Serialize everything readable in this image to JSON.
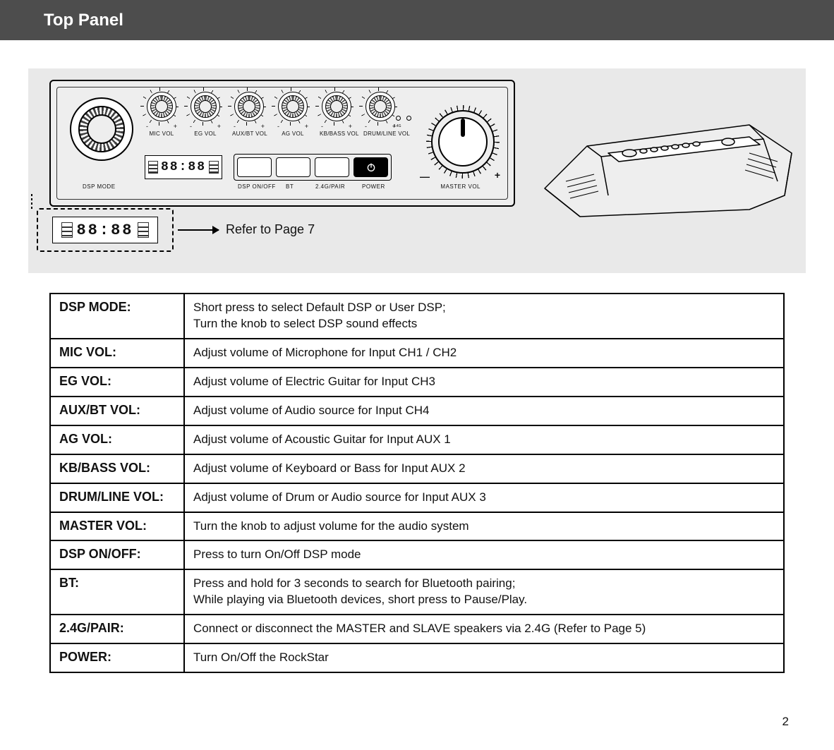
{
  "header": {
    "title": "Top Panel"
  },
  "panel": {
    "dsp_mode_label": "DSP MODE",
    "knobs": [
      {
        "label": "MIC VOL"
      },
      {
        "label": "EG VOL"
      },
      {
        "label": "AUX/BT VOL"
      },
      {
        "label": "AG VOL"
      },
      {
        "label": "KB/BASS VOL"
      },
      {
        "label": "DRUM/LINE VOL"
      }
    ],
    "knob_minus": "-",
    "knob_plus": "+",
    "lcd_text": "88:88",
    "button_labels": [
      "DSP ON/OFF",
      "BT",
      "2.4G/PAIR",
      "POWER"
    ],
    "master_label": "MASTER VOL",
    "master_minus": "—",
    "master_plus": "+",
    "indicator_label_left": "2.4G",
    "indicator_label_right": ""
  },
  "callout": {
    "lcd_text": "88:88",
    "refer_text": "Refer to Page 7"
  },
  "controls": [
    {
      "label": "DSP MODE:",
      "desc": "Short press to select Default DSP or User DSP;\nTurn the knob to select DSP sound effects"
    },
    {
      "label": "MIC VOL:",
      "desc": "Adjust volume of Microphone for Input CH1 / CH2"
    },
    {
      "label": "EG VOL:",
      "desc": "Adjust volume of Electric Guitar for Input CH3"
    },
    {
      "label": "AUX/BT VOL:",
      "desc": "Adjust volume of Audio source for Input CH4"
    },
    {
      "label": "AG VOL:",
      "desc": "Adjust volume of Acoustic Guitar for Input AUX 1"
    },
    {
      "label": "KB/BASS VOL:",
      "desc": "Adjust volume of Keyboard or Bass for Input AUX 2"
    },
    {
      "label": "DRUM/LINE VOL:",
      "desc": "Adjust volume of Drum or Audio source for Input AUX 3"
    },
    {
      "label": "MASTER VOL:",
      "desc": "Turn the knob to adjust volume for the audio system"
    },
    {
      "label": "DSP ON/OFF:",
      "desc": "Press to turn On/Off DSP mode"
    },
    {
      "label": "BT:",
      "desc": "Press and hold for 3 seconds to search for Bluetooth pairing;\nWhile playing via Bluetooth devices,  short press to Pause/Play."
    },
    {
      "label": "2.4G/PAIR:",
      "desc": "Connect or disconnect the MASTER and SLAVE speakers via 2.4G (Refer to Page 5)"
    },
    {
      "label": "POWER:",
      "desc": "Turn On/Off the RockStar"
    }
  ],
  "page_number": "2"
}
